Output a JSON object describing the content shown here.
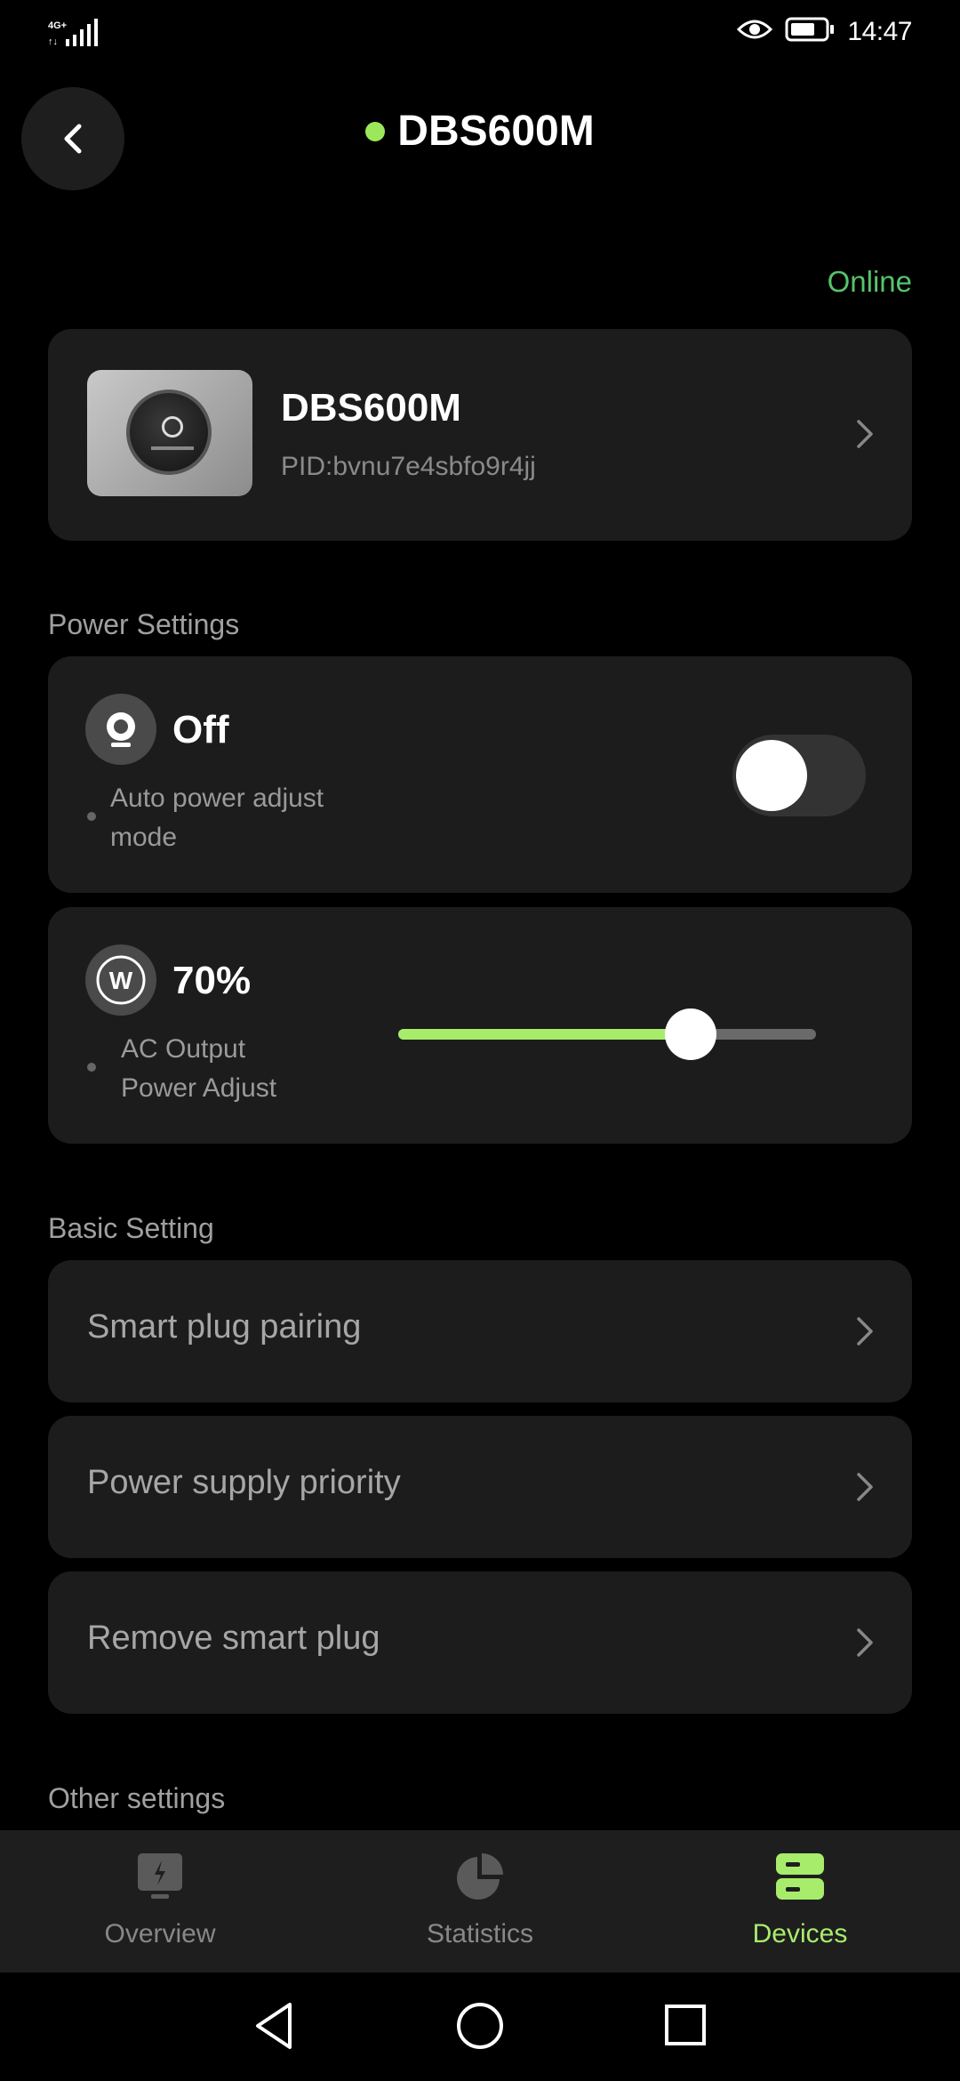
{
  "status_bar": {
    "network": "4G+",
    "time": "14:47"
  },
  "header": {
    "title": "DBS600M",
    "online_status": "Online"
  },
  "device": {
    "name": "DBS600M",
    "pid": "PID:bvnu7e4sbfo9r4jj"
  },
  "power_settings": {
    "section_label": "Power Settings",
    "auto_power": {
      "value": "Off",
      "label": "Auto power adjust mode",
      "enabled": false
    },
    "ac_output": {
      "value": "70%",
      "label": "AC Output Power Adjust",
      "percent": 70
    }
  },
  "basic_setting": {
    "section_label": "Basic Setting",
    "items": [
      {
        "label": "Smart plug pairing"
      },
      {
        "label": "Power supply priority"
      },
      {
        "label": "Remove smart plug"
      }
    ]
  },
  "other_settings": {
    "section_label": "Other settings"
  },
  "bottom_nav": {
    "items": [
      {
        "label": "Overview",
        "icon": "overview-icon"
      },
      {
        "label": "Statistics",
        "icon": "statistics-icon"
      },
      {
        "label": "Devices",
        "icon": "devices-icon"
      }
    ],
    "active": "Devices"
  },
  "colors": {
    "accent": "#a8ec6b",
    "online": "#56c46b",
    "card": "#1c1c1c"
  }
}
